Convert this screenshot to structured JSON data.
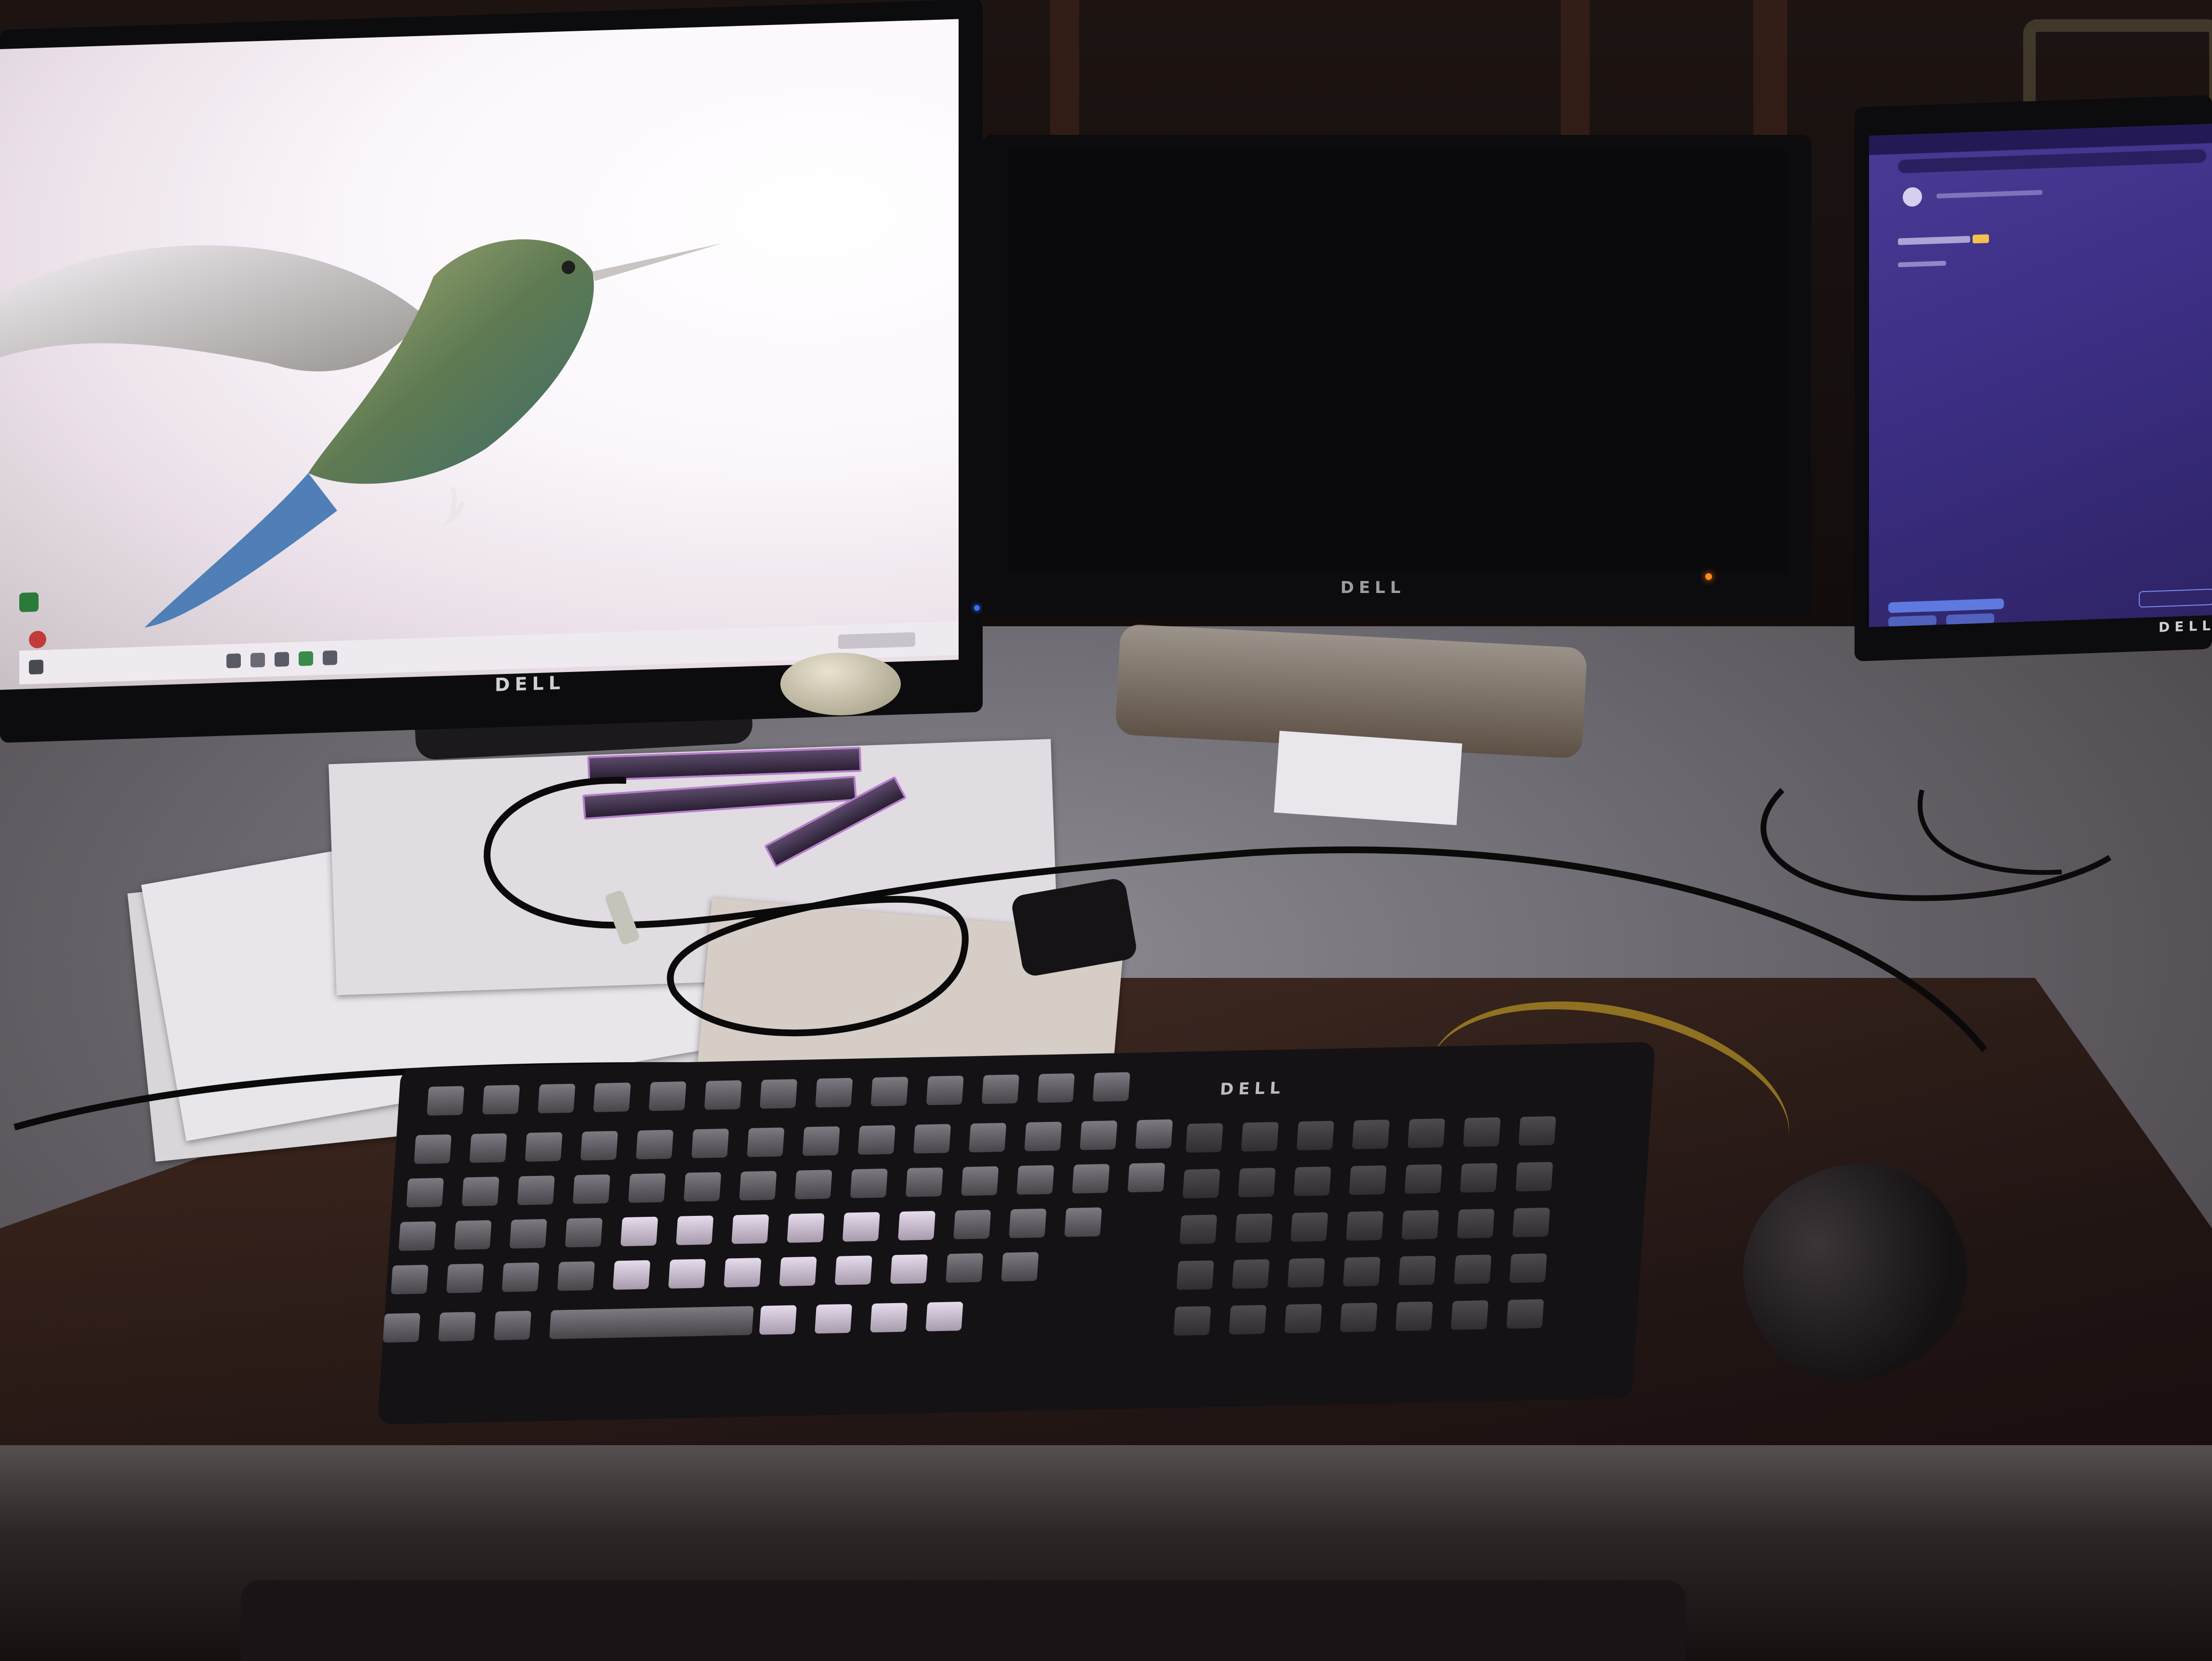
{
  "scene": {
    "monitors": {
      "left": {
        "brand": "DELL",
        "screen": "desktop wallpaper"
      },
      "middle": {
        "brand": "DELL",
        "screen": "off"
      },
      "right": {
        "brand": "DELL",
        "screen": "browser"
      }
    },
    "keyboard": {
      "brand": "DELL"
    }
  },
  "colors": {
    "desk": "#6a666d",
    "screen_left": "#fbf6fb",
    "screen_right": "#3b2e82",
    "led_orange": "#ff8a1a",
    "led_blue": "#3a6cff"
  }
}
